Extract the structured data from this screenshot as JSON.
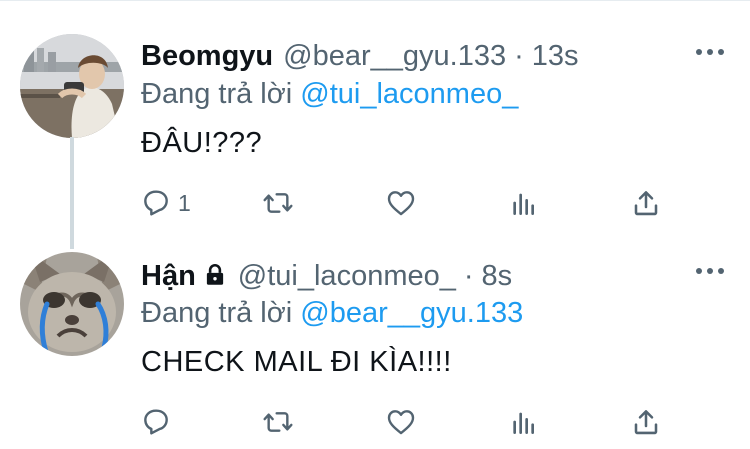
{
  "tweets": [
    {
      "name": "Beomgyu",
      "handle": "@bear__gyu.133",
      "separator": "·",
      "time": "13s",
      "reply_prefix": "Đang trả lời",
      "reply_to": "@tui_laconmeo_",
      "text": "ĐÂU!???",
      "reply_count": "1",
      "protected": false
    },
    {
      "name": "Hận",
      "handle": "@tui_laconmeo_",
      "separator": "·",
      "time": "8s",
      "reply_prefix": "Đang trả lời",
      "reply_to": "@bear__gyu.133",
      "text": "CHECK MAIL ĐI KÌA!!!!",
      "reply_count": "",
      "protected": true
    }
  ],
  "icons": {
    "reply": "reply-icon",
    "retweet": "retweet-icon",
    "like": "heart-icon",
    "analytics": "analytics-icon",
    "share": "share-icon",
    "more": "more-icon",
    "lock": "lock-icon"
  },
  "colors": {
    "text": "#0f1419",
    "secondary": "#536471",
    "link": "#1d9bf0",
    "thread_line": "#cfd9de"
  }
}
